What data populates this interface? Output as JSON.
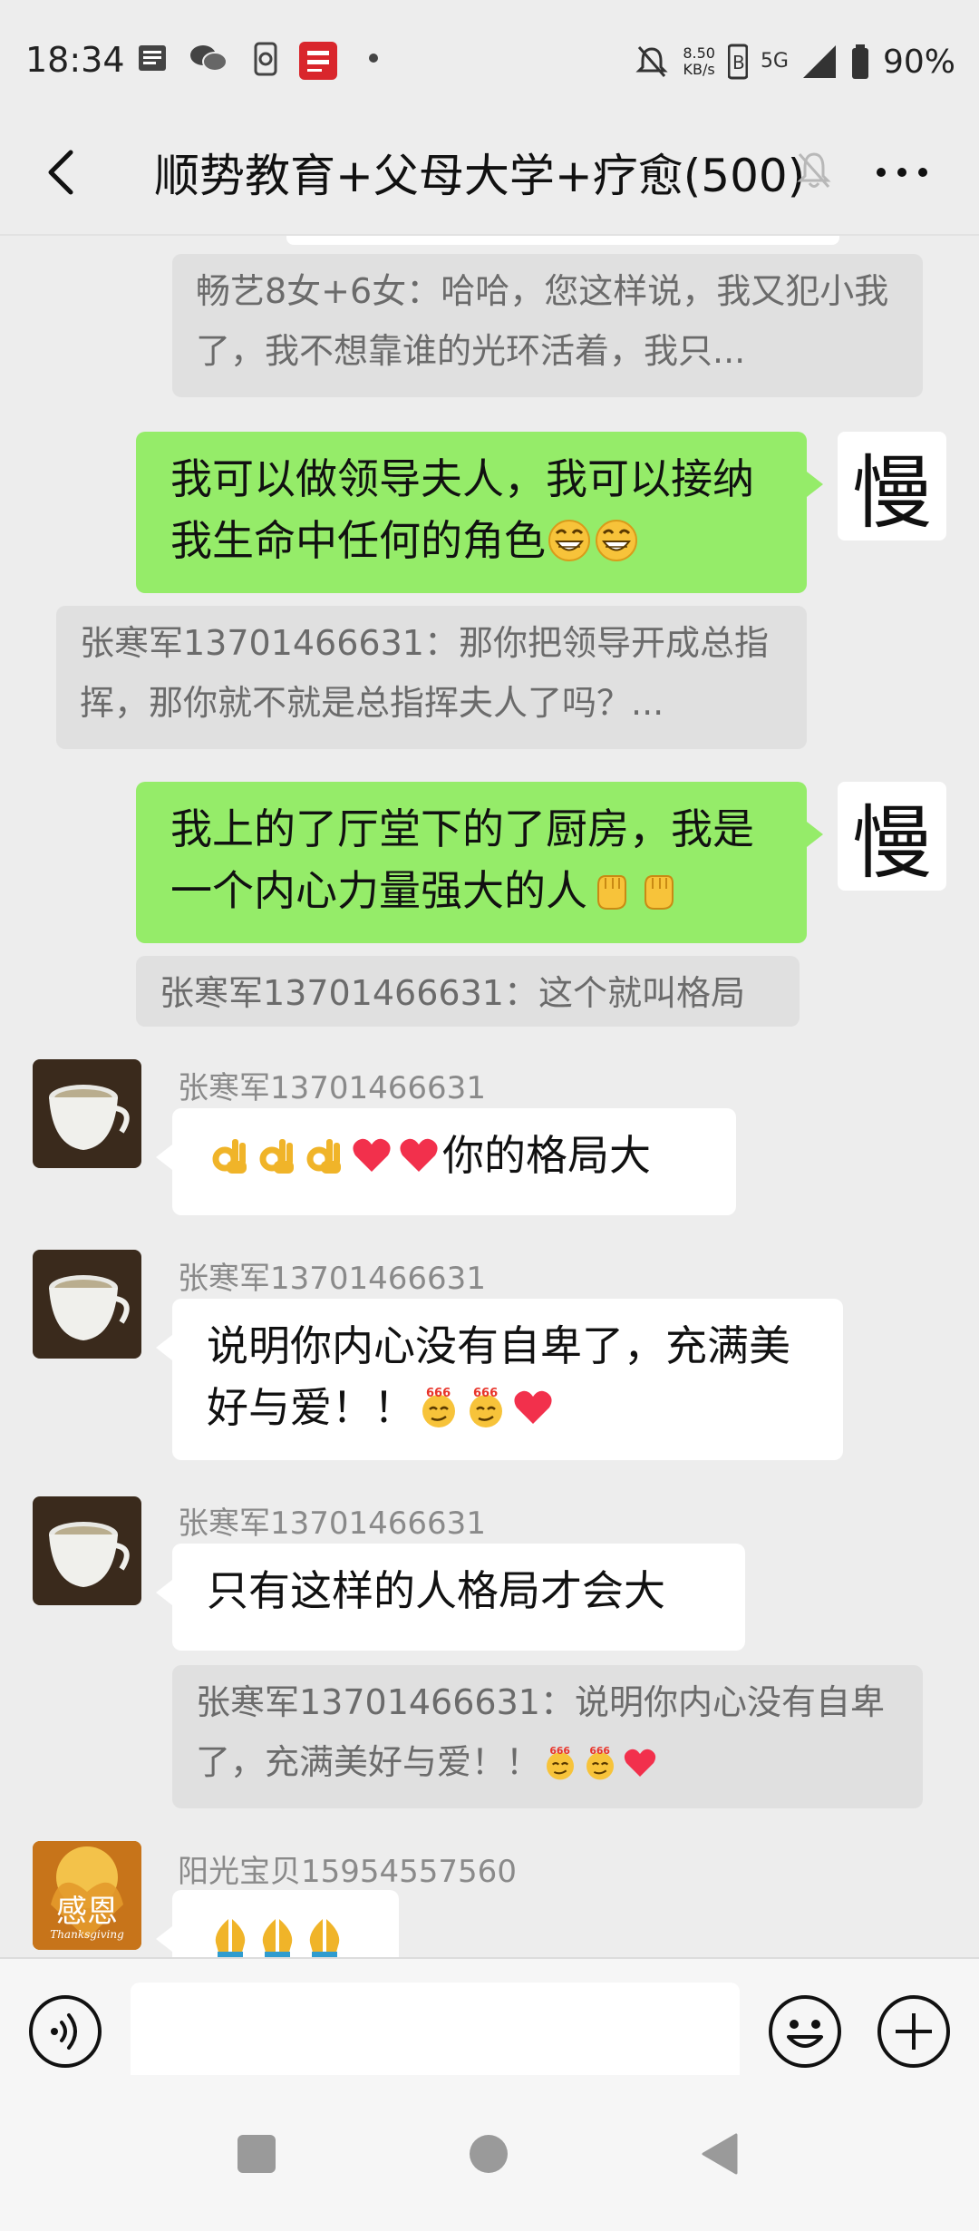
{
  "status_bar": {
    "time": "18:34",
    "net_speed_value": "8.50",
    "net_speed_unit": "KB/s",
    "signal_label": "5G",
    "battery": "90%"
  },
  "title_bar": {
    "title": "顺势教育+父母大学+疗愈(500)"
  },
  "messages": [
    {
      "type": "quote",
      "text": "畅艺8女+6女：哈哈，您这样说，我又犯小我了，我不想靠谁的光环活着，我只..."
    },
    {
      "type": "self",
      "text": "我可以做领导夫人，我可以接纳我生命中任何的角色",
      "emojis": [
        "grin",
        "grin"
      ],
      "avatar_char": "慢"
    },
    {
      "type": "quote",
      "text": "张寒军13701466631：那你把领导开成总指挥，那你就不就是总指挥夫人了吗？..."
    },
    {
      "type": "self",
      "text": "我上的了厅堂下的了厨房，我是一个内心力量强大的人",
      "emojis": [
        "fist",
        "fist"
      ],
      "avatar_char": "慢"
    },
    {
      "type": "quote",
      "text": "张寒军13701466631：这个就叫格局"
    },
    {
      "type": "other",
      "sender": "张寒军13701466631",
      "text": "你的格局大",
      "emojis_before": [
        "ok",
        "ok",
        "ok",
        "heart",
        "heart"
      ]
    },
    {
      "type": "other",
      "sender": "张寒军13701466631",
      "text": "说明你内心没有自卑了，充满美好与爱！！",
      "emojis": [
        "666",
        "666",
        "heart"
      ]
    },
    {
      "type": "other",
      "sender": "张寒军13701466631",
      "text": "只有这样的人格局才会大"
    },
    {
      "type": "quote",
      "text": "张寒军13701466631：说明你内心没有自卑了，充满美好与爱！！",
      "emojis": [
        "666",
        "666",
        "heart"
      ]
    },
    {
      "type": "other",
      "sender": "阳光宝贝15954557560",
      "avatar_text": "感恩",
      "avatar_subtext": "Thanksgiving",
      "emojis": [
        "pray",
        "pray",
        "pray"
      ]
    }
  ],
  "input": {
    "placeholder": ""
  },
  "colors": {
    "self_bubble": "#95ec69",
    "other_bubble": "#ffffff",
    "quote_bg": "#e0e0e0",
    "chat_bg": "#ededed"
  }
}
